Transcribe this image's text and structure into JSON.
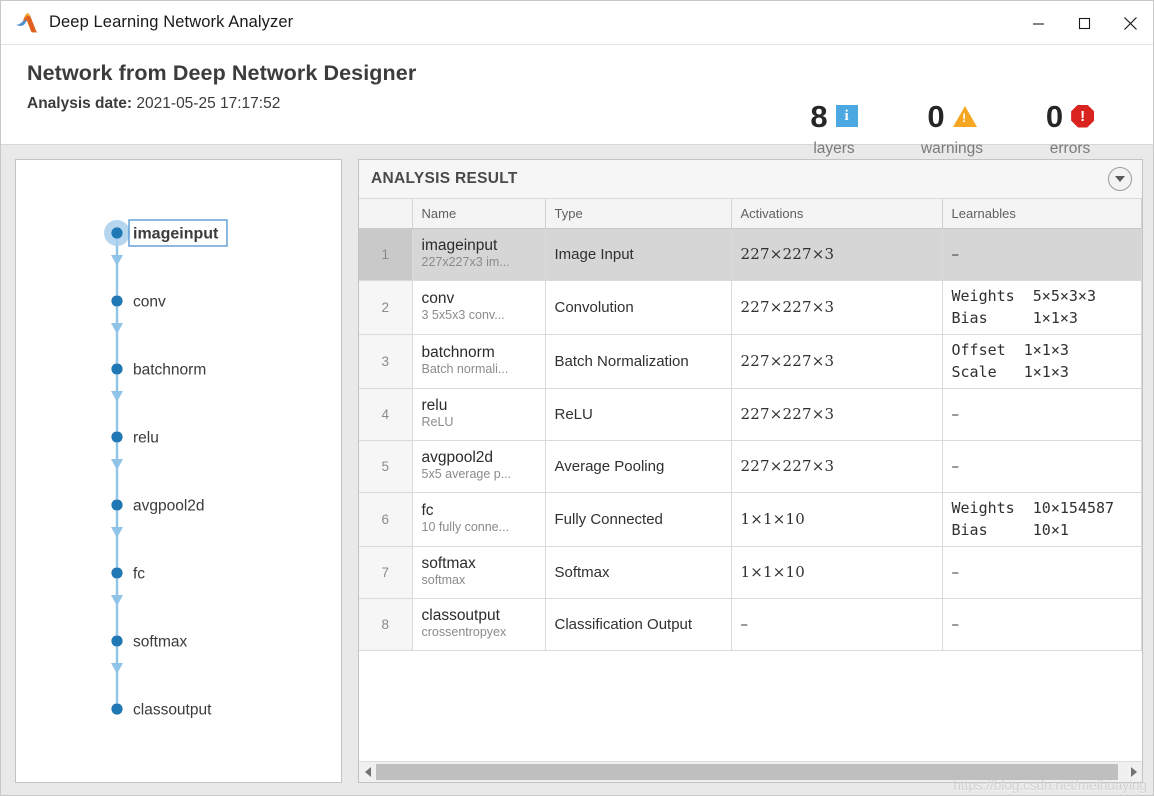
{
  "window": {
    "title": "Deep Learning Network Analyzer",
    "logo_icon": "matlab-membrane-icon",
    "minimize_label": "—",
    "maximize_label": "☐",
    "close_label": "✕"
  },
  "header": {
    "network_title": "Network from Deep Network Designer",
    "analysis_date_label": "Analysis date:",
    "analysis_date_value": "2021-05-25 17:17:52",
    "stats": [
      {
        "count": "8",
        "label": "layers",
        "icon": "info-icon",
        "color": "#4ba8e0",
        "glyph": "i"
      },
      {
        "count": "0",
        "label": "warnings",
        "icon": "warning-icon",
        "color": "#f5a623",
        "glyph": "!"
      },
      {
        "count": "0",
        "label": "errors",
        "icon": "error-icon",
        "color": "#d9231f",
        "glyph": "!"
      }
    ]
  },
  "graph": {
    "node_color": "#1f77b4",
    "edge_color": "#8fc4e8",
    "selected_node": "imageinput",
    "nodes": [
      {
        "label": "imageinput",
        "selected": true
      },
      {
        "label": "conv",
        "selected": false
      },
      {
        "label": "batchnorm",
        "selected": false
      },
      {
        "label": "relu",
        "selected": false
      },
      {
        "label": "avgpool2d",
        "selected": false
      },
      {
        "label": "fc",
        "selected": false
      },
      {
        "label": "softmax",
        "selected": false
      },
      {
        "label": "classoutput",
        "selected": false
      }
    ]
  },
  "result_panel": {
    "title": "ANALYSIS RESULT",
    "collapse_icon": "chevron-down-icon",
    "columns": [
      "",
      "Name",
      "Type",
      "Activations",
      "Learnables"
    ],
    "rows": [
      {
        "index": "1",
        "selected": true,
        "name": "imageinput",
        "sub": "227x227x3 im...",
        "type": "Image Input",
        "activations": "227×227×3",
        "learnables": "–"
      },
      {
        "index": "2",
        "selected": false,
        "name": "conv",
        "sub": "3 5x5x3 conv...",
        "type": "Convolution",
        "activations": "227×227×3",
        "learnables": "Weights  5×5×3×3\nBias     1×1×3"
      },
      {
        "index": "3",
        "selected": false,
        "name": "batchnorm",
        "sub": "Batch normali...",
        "type": "Batch Normalization",
        "activations": "227×227×3",
        "learnables": "Offset  1×1×3\nScale   1×1×3"
      },
      {
        "index": "4",
        "selected": false,
        "name": "relu",
        "sub": "ReLU",
        "type": "ReLU",
        "activations": "227×227×3",
        "learnables": "–"
      },
      {
        "index": "5",
        "selected": false,
        "name": "avgpool2d",
        "sub": "5x5 average p...",
        "type": "Average Pooling",
        "activations": "227×227×3",
        "learnables": "–"
      },
      {
        "index": "6",
        "selected": false,
        "name": "fc",
        "sub": "10 fully conne...",
        "type": "Fully Connected",
        "activations": "1×1×10",
        "learnables": "Weights  10×154587\nBias     10×1"
      },
      {
        "index": "7",
        "selected": false,
        "name": "softmax",
        "sub": "softmax",
        "type": "Softmax",
        "activations": "1×1×10",
        "learnables": "–"
      },
      {
        "index": "8",
        "selected": false,
        "name": "classoutput",
        "sub": "crossentropyex",
        "type": "Classification Output",
        "activations": "–",
        "learnables": "–"
      }
    ]
  },
  "scrollbar": {
    "left_arrow": "◀",
    "right_arrow": "▶"
  },
  "watermark": "https://blog.csdn.net/meihuaying"
}
